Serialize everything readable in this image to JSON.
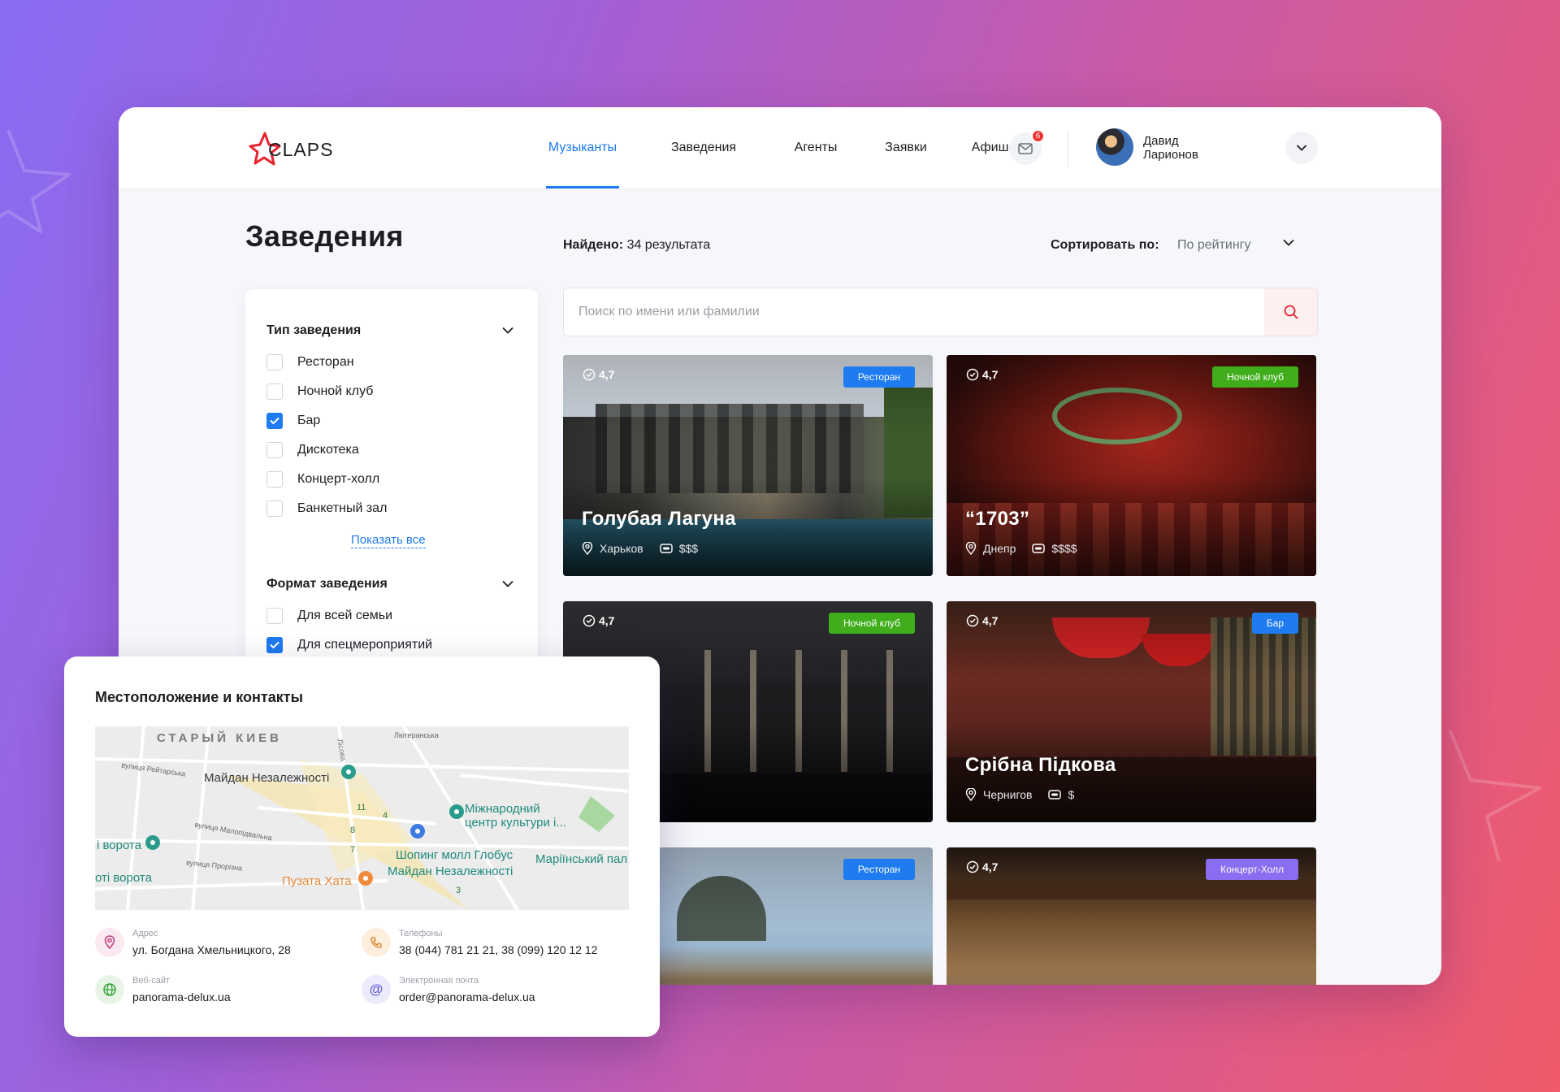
{
  "brand": {
    "name": "CLAPS",
    "accent": "#e8232f"
  },
  "nav": {
    "items": [
      {
        "label": "Музыканты",
        "active": true
      },
      {
        "label": "Заведения",
        "active": false
      },
      {
        "label": "Агенты",
        "active": false
      },
      {
        "label": "Заявки",
        "active": false
      },
      {
        "label": "Афиша",
        "active": false
      }
    ],
    "mail_count": "6"
  },
  "user": {
    "first_name": "Давид",
    "last_name": "Ларионов"
  },
  "page": {
    "title": "Заведения",
    "found_label": "Найдено:",
    "found_value": "34 результата",
    "sort_label": "Сортировать по:",
    "sort_value": "По рейтингу"
  },
  "search": {
    "placeholder": "Поиск по имени или фамилии"
  },
  "filters": {
    "type": {
      "title": "Тип заведения",
      "options": [
        {
          "label": "Ресторан",
          "checked": false
        },
        {
          "label": "Ночной клуб",
          "checked": false
        },
        {
          "label": "Бар",
          "checked": true
        },
        {
          "label": "Дискотека",
          "checked": false
        },
        {
          "label": "Концерт-холл",
          "checked": false
        },
        {
          "label": "Банкетный зал",
          "checked": false
        }
      ],
      "show_all": "Показать все"
    },
    "format": {
      "title": "Формат заведения",
      "options": [
        {
          "label": "Для всей семьи",
          "checked": false
        },
        {
          "label": "Для спецмероприятий",
          "checked": true
        }
      ]
    }
  },
  "venues": [
    {
      "rating": "4,7",
      "badge": "Ресторан",
      "badge_color": "#1e7bf0",
      "title": "Голубая Лагуна",
      "city": "Харьков",
      "price": "$$$"
    },
    {
      "rating": "4,7",
      "badge": "Ночной клуб",
      "badge_color": "#3fae1a",
      "title": "“1703”",
      "city": "Днепр",
      "price": "$$$$"
    },
    {
      "rating": "4,7",
      "badge": "Ночной клуб",
      "badge_color": "#3fae1a",
      "title": "",
      "city": "",
      "price": "$$$"
    },
    {
      "rating": "4,7",
      "badge": "Бар",
      "badge_color": "#1e7bf0",
      "title": "Срібна Підкова",
      "city": "Чернигов",
      "price": "$"
    },
    {
      "rating": "",
      "badge": "Ресторан",
      "badge_color": "#1e7bf0",
      "title": "",
      "city": "",
      "price": ""
    },
    {
      "rating": "4,7",
      "badge": "Концерт-Холл",
      "badge_color": "#8a6df0",
      "title": "",
      "city": "",
      "price": ""
    }
  ],
  "contacts": {
    "title": "Местоположение и контакты",
    "map_labels": [
      "СТАРЫЙ КИЕВ",
      "Майдан Незалежності",
      "Міжнародний",
      "центр культури і...",
      "Шопинг молл Глобус",
      "Майдан Незалежності",
      "Маріїнський пал",
      "і ворота",
      "оті ворота",
      "Пузата Хата",
      "вулиця Рейтарська",
      "вулиця Малопідвальна",
      "вулиця Прорізна",
      "Лютеранська",
      "11",
      "4",
      "8",
      "7",
      "3",
      "Лісова"
    ],
    "address_caption": "Адрес",
    "address": "ул. Богдана Хмельницкого, 28",
    "phones_caption": "Телефоны",
    "phones": "38 (044) 781 21 21, 38 (099) 120 12 12",
    "website_caption": "Веб-сайт",
    "website": "panorama-delux.ua",
    "email_caption": "Электронная почта",
    "email": "order@panorama-delux.ua"
  }
}
